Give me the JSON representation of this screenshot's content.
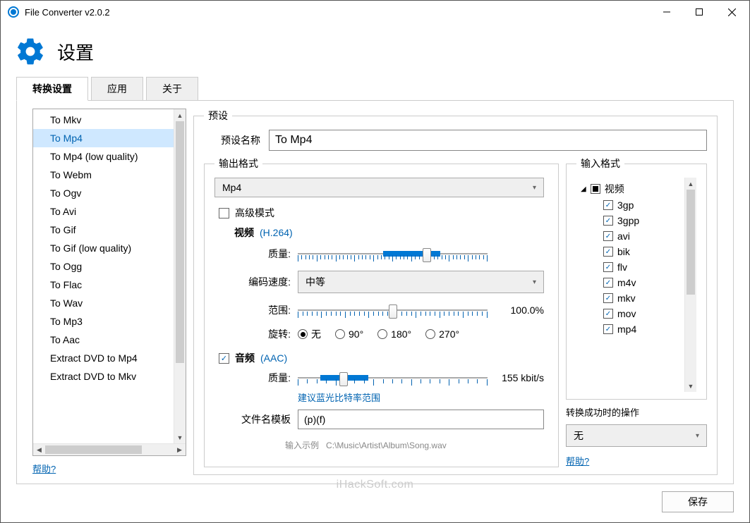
{
  "title": "File Converter v2.0.2",
  "header": {
    "title": "设置"
  },
  "tabs": {
    "t0": "转换设置",
    "t1": "应用",
    "t2": "关于"
  },
  "presets": {
    "items": [
      "To Mkv",
      "To Mp4",
      "To Mp4 (low quality)",
      "To Webm",
      "To Ogv",
      "To Avi",
      "To Gif",
      "To Gif (low quality)",
      "To Ogg",
      "To Flac",
      "To Wav",
      "To Mp3",
      "To Aac",
      "Extract DVD to Mp4",
      "Extract DVD to Mkv"
    ],
    "selected_index": 1
  },
  "help": "帮助?",
  "preset": {
    "legend": "预设",
    "name_label": "预设名称",
    "name_value": "To Mp4"
  },
  "output": {
    "legend": "输出格式",
    "format_value": "Mp4",
    "advanced_label": "高级模式",
    "advanced_checked": false,
    "video": {
      "label": "视频",
      "codec": "(H.264)"
    },
    "quality_label": "质量:",
    "encode_speed_label": "编码速度:",
    "encode_speed_value": "中等",
    "range_label": "范围:",
    "range_value": "100.0%",
    "rotate_label": "旋转:",
    "rotate_options": {
      "r0": "无",
      "r1": "90°",
      "r2": "180°",
      "r3": "270°"
    },
    "rotate_selected": 0,
    "audio": {
      "label": "音频",
      "codec": "(AAC)",
      "checked": true
    },
    "audio_quality_value": "155 kbit/s",
    "bitrate_hint": "建议蓝光比特率范围",
    "filename_label": "文件名模板",
    "filename_value": "(p)(f)",
    "example_label": "输入示例",
    "example_value": "C:\\Music\\Artist\\Album\\Song.wav"
  },
  "input": {
    "legend": "输入格式",
    "root": "视频",
    "items": [
      "3gp",
      "3gpp",
      "avi",
      "bik",
      "flv",
      "m4v",
      "mkv",
      "mov",
      "mp4"
    ]
  },
  "action": {
    "label": "转换成功时的操作",
    "value": "无"
  },
  "save": "保存",
  "watermark": "iHackSoft.com"
}
